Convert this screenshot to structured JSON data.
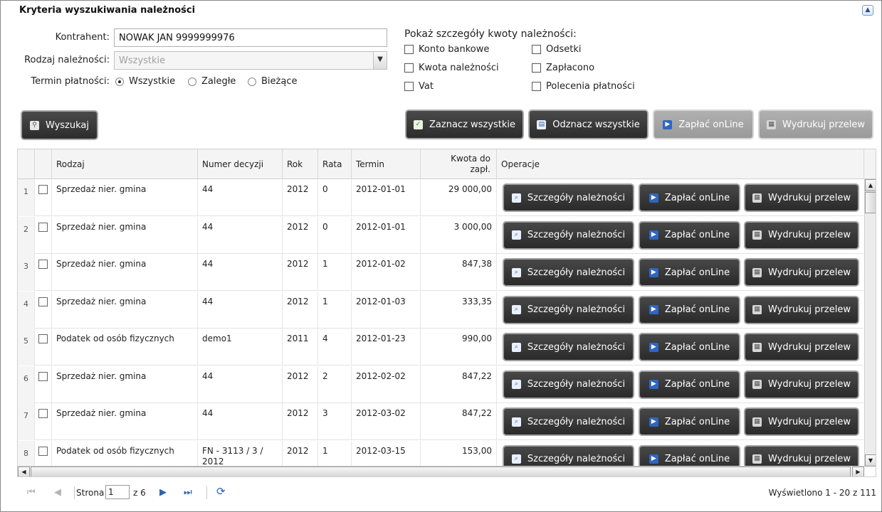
{
  "panel": {
    "title": "Kryteria wyszukiwania należności",
    "collapse_glyph": "▲"
  },
  "form": {
    "contractor_label": "Kontrahent:",
    "contractor_value": "NOWAK JAN 9999999976",
    "type_label": "Rodzaj należności:",
    "type_value": "Wszystkie",
    "term_label": "Termin płatności:",
    "term_options": [
      {
        "label": "Wszystkie",
        "selected": true
      },
      {
        "label": "Zaległe",
        "selected": false
      },
      {
        "label": "Bieżące",
        "selected": false
      }
    ]
  },
  "details": {
    "title": "Pokaż szczegóły kwoty należności:",
    "options": [
      {
        "label": "Konto bankowe",
        "checked": false
      },
      {
        "label": "Odsetki",
        "checked": false
      },
      {
        "label": "Kwota należności",
        "checked": false
      },
      {
        "label": "Zapłacono",
        "checked": false
      },
      {
        "label": "Vat",
        "checked": false
      },
      {
        "label": "Polecenia płatności",
        "checked": false
      }
    ]
  },
  "toolbar": {
    "search_label": "Wyszukaj",
    "select_all_label": "Zaznacz wszystkie",
    "deselect_all_label": "Odznacz wszystkie",
    "pay_online_label": "Zapłać onLine",
    "print_transfer_label": "Wydrukuj przelew"
  },
  "table": {
    "headers": {
      "type": "Rodzaj",
      "decision": "Numer decyzji",
      "year": "Rok",
      "installment": "Rata",
      "term": "Termin",
      "amount": "Kwota do zapł.",
      "operations": "Operacje"
    },
    "operation_labels": {
      "details": "Szczegóły należności",
      "pay": "Zapłać onLine",
      "print": "Wydrukuj przelew"
    },
    "rows": [
      {
        "n": "1",
        "type": "Sprzedaż nier. gmina",
        "decision": "44",
        "year": "2012",
        "installment": "0",
        "term": "2012-01-01",
        "amount": "29 000,00"
      },
      {
        "n": "2",
        "type": "Sprzedaż nier. gmina",
        "decision": "44",
        "year": "2012",
        "installment": "0",
        "term": "2012-01-01",
        "amount": "3 000,00"
      },
      {
        "n": "3",
        "type": "Sprzedaż nier. gmina",
        "decision": "44",
        "year": "2012",
        "installment": "1",
        "term": "2012-01-02",
        "amount": "847,38"
      },
      {
        "n": "4",
        "type": "Sprzedaż nier. gmina",
        "decision": "44",
        "year": "2012",
        "installment": "1",
        "term": "2012-01-03",
        "amount": "333,35"
      },
      {
        "n": "5",
        "type": "Podatek od osób fizycznych",
        "decision": "demo1",
        "year": "2011",
        "installment": "4",
        "term": "2012-01-23",
        "amount": "990,00"
      },
      {
        "n": "6",
        "type": "Sprzedaż nier. gmina",
        "decision": "44",
        "year": "2012",
        "installment": "2",
        "term": "2012-02-02",
        "amount": "847,22"
      },
      {
        "n": "7",
        "type": "Sprzedaż nier. gmina",
        "decision": "44",
        "year": "2012",
        "installment": "3",
        "term": "2012-03-02",
        "amount": "847,22"
      },
      {
        "n": "8",
        "type": "Podatek od osób fizycznych",
        "decision": "FN - 3113 / 3 / 2012",
        "year": "2012",
        "installment": "1",
        "term": "2012-03-15",
        "amount": "153,00"
      }
    ]
  },
  "pager": {
    "page_label": "Strona",
    "page_value": "1",
    "of_label": "z 6",
    "status": "Wyświetlono 1 - 20 z 111"
  },
  "icons": {
    "search": "search-icon",
    "check": "checkbox-checked-icon",
    "doc": "document-icon",
    "play": "play-icon",
    "print": "printer-icon",
    "details": "magnifier-document-icon"
  }
}
